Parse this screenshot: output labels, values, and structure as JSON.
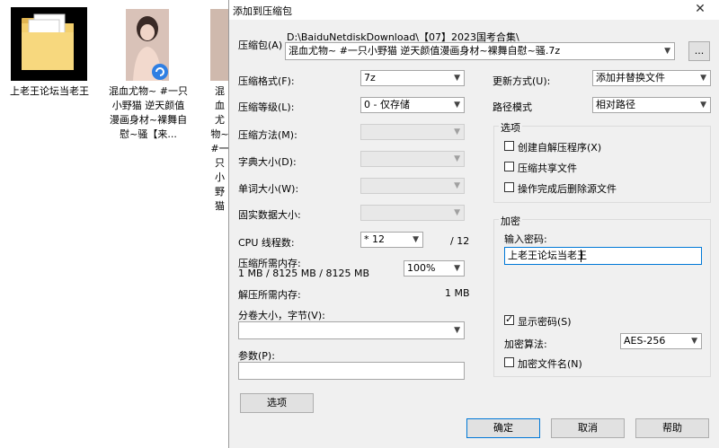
{
  "desktop": {
    "folder_label": "上老王论坛当老王",
    "file1_label": "混血尤物~ #一只小野猫 逆天颜值漫画身材~裸舞自慰~骚【来...",
    "file2_label": "混血尤物~ #一只小野猫"
  },
  "dialog": {
    "title": "添加到压缩包",
    "archive": {
      "label": "压缩包(A)",
      "path": "D:\\BaiduNetdiskDownload\\【07】2023国考合集\\",
      "name": "混血尤物~ #一只小野猫 逆天颜值漫画身材~裸舞自慰~骚.7z",
      "browse_label": "..."
    },
    "format": {
      "label": "压缩格式(F):",
      "value": "7z"
    },
    "level": {
      "label": "压缩等级(L):",
      "value": "0 - 仅存储"
    },
    "method": {
      "label": "压缩方法(M):"
    },
    "dict": {
      "label": "字典大小(D):"
    },
    "word": {
      "label": "单词大小(W):"
    },
    "solid": {
      "label": "固实数据大小:"
    },
    "cpu": {
      "label": "CPU 线程数:",
      "value": "* 12",
      "max": "/ 12"
    },
    "mem_comp": {
      "label": "压缩所需内存:",
      "detail": "1 MB / 8125 MB / 8125 MB",
      "percent": "100%"
    },
    "mem_decomp": {
      "label": "解压所需内存:",
      "value": "1 MB"
    },
    "split": {
      "label": "分卷大小，字节(V):",
      "value": ""
    },
    "params": {
      "label": "参数(P):",
      "value": ""
    },
    "options_button": "选项",
    "update": {
      "label": "更新方式(U):",
      "value": "添加并替换文件"
    },
    "pathmode": {
      "label": "路径模式",
      "value": "相对路径"
    },
    "options_group": {
      "title": "选项",
      "sfx": "创建自解压程序(X)",
      "shared": "压缩共享文件",
      "delete": "操作完成后删除源文件"
    },
    "encryption": {
      "title": "加密",
      "password_label": "输入密码:",
      "password_value": "上老王论坛当老王",
      "show_password": "显示密码(S)",
      "method_label": "加密算法:",
      "method_value": "AES-256",
      "encrypt_names": "加密文件名(N)"
    },
    "ok": "确定",
    "cancel": "取消",
    "help": "帮助"
  }
}
